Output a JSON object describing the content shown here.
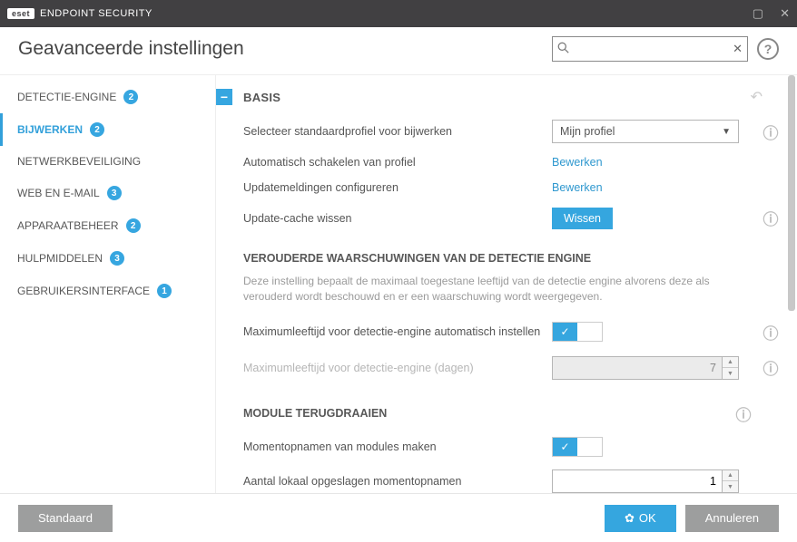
{
  "titlebar": {
    "brand_badge": "eset",
    "product": "ENDPOINT SECURITY"
  },
  "header": {
    "title": "Geavanceerde instellingen"
  },
  "search": {
    "placeholder": ""
  },
  "sidebar": {
    "items": [
      {
        "label": "DETECTIE-ENGINE",
        "badge": "2"
      },
      {
        "label": "BIJWERKEN",
        "badge": "2"
      },
      {
        "label": "NETWERKBEVEILIGING",
        "badge": ""
      },
      {
        "label": "WEB EN E-MAIL",
        "badge": "3"
      },
      {
        "label": "APPARAATBEHEER",
        "badge": "2"
      },
      {
        "label": "HULPMIDDELEN",
        "badge": "3"
      },
      {
        "label": "GEBRUIKERSINTERFACE",
        "badge": "1"
      }
    ]
  },
  "sections": {
    "basic": {
      "title": "BASIS",
      "profile_label": "Selecteer standaardprofiel voor bijwerken",
      "profile_value": "Mijn profiel",
      "auto_switch_label": "Automatisch schakelen van profiel",
      "auto_switch_link": "Bewerken",
      "notif_label": "Updatemeldingen configureren",
      "notif_link": "Bewerken",
      "clear_cache_label": "Update-cache wissen",
      "clear_cache_btn": "Wissen"
    },
    "outdated": {
      "title": "VEROUDERDE WAARSCHUWINGEN VAN DE DETECTIE ENGINE",
      "desc": "Deze instelling bepaalt de maximaal toegestane leeftijd van de detectie engine alvorens deze als verouderd wordt beschouwd en er een waarschuwing wordt weergegeven.",
      "auto_max_label": "Maximumleeftijd voor detectie-engine automatisch instellen",
      "max_days_label": "Maximumleeftijd voor detectie-engine (dagen)",
      "max_days_value": "7"
    },
    "rollback": {
      "title": "MODULE TERUGDRAAIEN",
      "snapshot_label": "Momentopnamen van modules maken",
      "local_count_label": "Aantal lokaal opgeslagen momentopnamen",
      "local_count_value": "1"
    }
  },
  "footer": {
    "default": "Standaard",
    "ok": "OK",
    "cancel": "Annuleren"
  },
  "glyphs": {
    "check": "✓"
  }
}
